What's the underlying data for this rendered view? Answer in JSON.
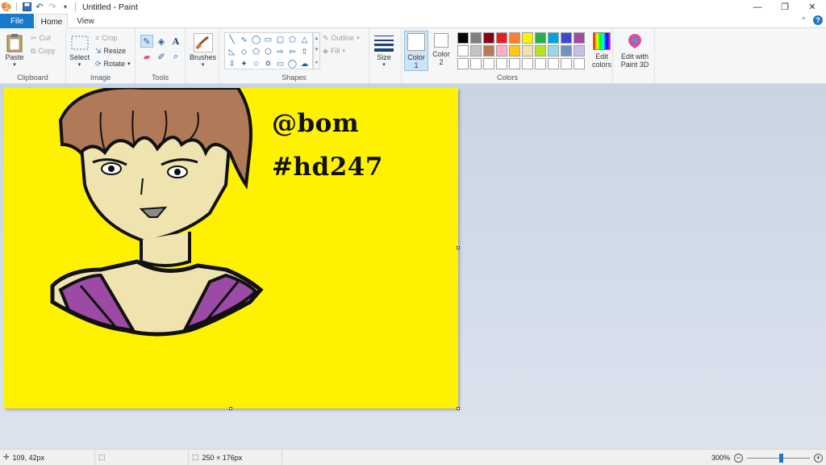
{
  "window": {
    "title": "Untitled - Paint",
    "controls": [
      "minimize-icon",
      "restore-icon",
      "close-icon"
    ]
  },
  "tabs": {
    "file": "File",
    "home": "Home",
    "view": "View"
  },
  "ribbon": {
    "clipboard": {
      "label": "Clipboard",
      "paste": "Paste",
      "cut": "Cut",
      "copy": "Copy"
    },
    "image": {
      "label": "Image",
      "select": "Select",
      "crop": "Crop",
      "resize": "Resize",
      "rotate": "Rotate"
    },
    "tools": {
      "label": "Tools"
    },
    "brushes": {
      "label": "Brushes"
    },
    "shapes": {
      "label": "Shapes",
      "outline": "Outline",
      "fill": "Fill"
    },
    "size": {
      "label": "Size"
    },
    "colors": {
      "label": "Colors",
      "color1": "Color 1",
      "color2": "Color 2",
      "edit_colors": "Edit colors",
      "edit_paint3d": "Edit with Paint 3D",
      "palette": [
        "#000000",
        "#7f7f7f",
        "#880015",
        "#ed1c24",
        "#ff7f27",
        "#fff200",
        "#22b14c",
        "#00a2e8",
        "#3f48cc",
        "#a349a4",
        "#ffffff",
        "#c3c3c3",
        "#b97a57",
        "#ffaec9",
        "#ffc90e",
        "#efe4b0",
        "#b5e61d",
        "#99d9ea",
        "#7092be",
        "#c8bfe7",
        "#ffffff",
        "#ffffff",
        "#ffffff",
        "#ffffff",
        "#ffffff",
        "#ffffff",
        "#ffffff",
        "#ffffff",
        "#ffffff",
        "#ffffff"
      ]
    }
  },
  "canvas": {
    "background": "#fff200",
    "text_line1": "@bom",
    "text_line2": "#hd247"
  },
  "status": {
    "cursor_pos": "109, 42px",
    "image_size": "250 × 176px",
    "zoom": "300%",
    "zoom_level_fraction": 0.55
  }
}
